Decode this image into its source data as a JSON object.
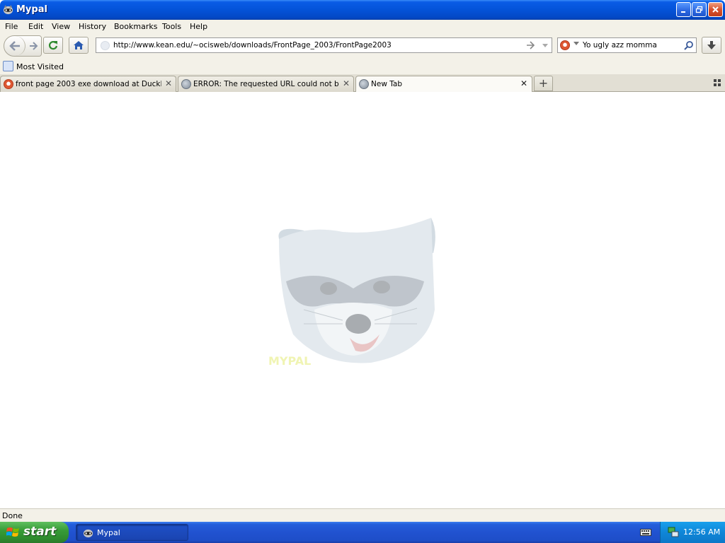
{
  "window": {
    "title": "Mypal"
  },
  "menu": [
    "File",
    "Edit",
    "View",
    "History",
    "Bookmarks",
    "Tools",
    "Help"
  ],
  "navigation": {
    "url": "http://www.kean.edu/~ocisweb/downloads/FrontPage_2003/FrontPage2003",
    "search_value": "Yo ugly azz momma"
  },
  "bookmarks": {
    "items": [
      {
        "label": "Most Visited",
        "icon": "bookmark-folder-icon"
      }
    ]
  },
  "tabs": [
    {
      "label": "front page 2003 exe download at DuckD...",
      "icon": "duckduckgo-icon"
    },
    {
      "label": "ERROR: The requested URL could not be...",
      "icon": "globe-icon"
    },
    {
      "label": "New Tab",
      "icon": "globe-icon",
      "active": true
    }
  ],
  "content": {
    "logo": "mypal-raccoon-logo",
    "logo_text": "MYPAL"
  },
  "status": {
    "text": "Done"
  },
  "taskbar": {
    "start_label": "start",
    "tasks": [
      {
        "label": "Mypal"
      }
    ],
    "clock": "12:56 AM"
  },
  "colors": {
    "titlebar": "#0453d8",
    "taskbar": "#245edb",
    "start": "#379c37",
    "tray": "#0f86d8",
    "chrome": "#f3f1e8"
  }
}
